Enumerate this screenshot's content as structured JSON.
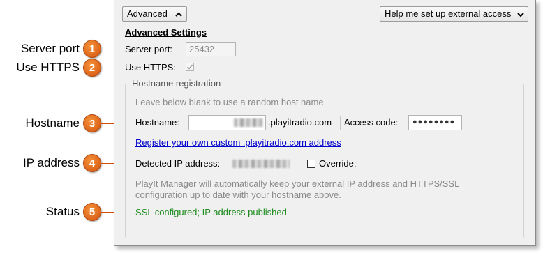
{
  "callouts": [
    {
      "number": "1",
      "label": "Server port"
    },
    {
      "number": "2",
      "label": "Use HTTPS"
    },
    {
      "number": "3",
      "label": "Hostname"
    },
    {
      "number": "4",
      "label": "IP address"
    },
    {
      "number": "5",
      "label": "Status"
    }
  ],
  "toolbar": {
    "advanced_label": "Advanced",
    "help_label": "Help me set up external access"
  },
  "settings": {
    "heading": "Advanced Settings",
    "server_port_label": "Server port:",
    "server_port_value": "25432",
    "use_https_label": "Use HTTPS:",
    "use_https_checked": true
  },
  "hostname_registration": {
    "legend": "Hostname registration",
    "hint": "Leave below blank to use a random host name",
    "hostname_label": "Hostname:",
    "hostname_suffix": ".playitradio.com",
    "access_code_label": "Access code:",
    "access_code_value": "●●●●●●●●",
    "register_link": "Register your own custom .playitradio.com address",
    "detected_ip_label": "Detected IP address:",
    "override_label": "Override:",
    "override_checked": false,
    "info_line1": "PlayIt Manager will automatically keep your external IP address and HTTPS/SSL",
    "info_line2": "configuration up to date with your hostname above.",
    "status": "SSL configured; IP address published"
  },
  "colors": {
    "badge": "#e46a1c",
    "status_green": "#1f8c1f",
    "link_blue": "#0000cc"
  }
}
